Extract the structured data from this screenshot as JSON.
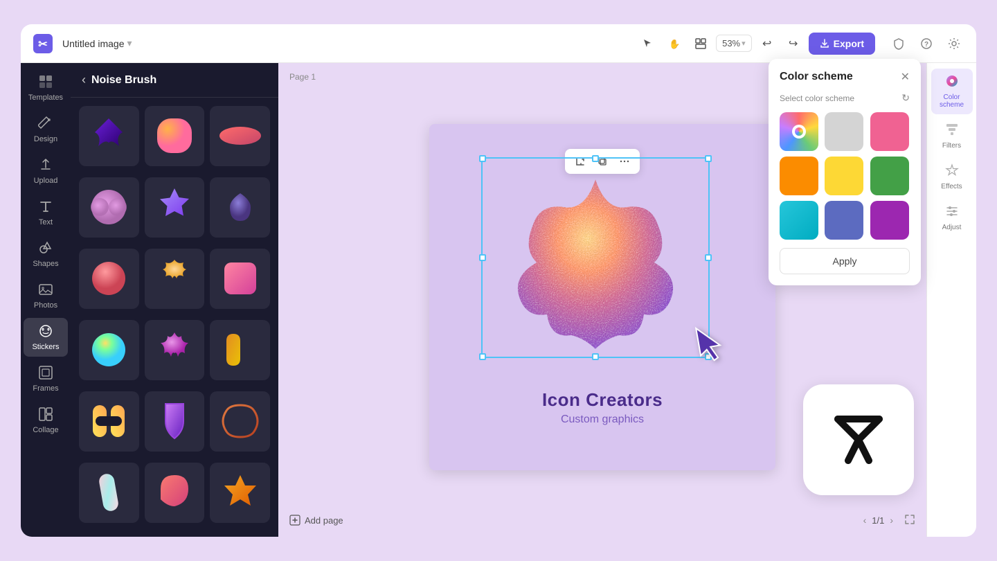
{
  "app": {
    "title": "Untitled image",
    "logo_symbol": "✂",
    "zoom": "53%"
  },
  "topbar": {
    "title": "Untitled image",
    "export_label": "Export",
    "zoom_label": "53%",
    "undo_icon": "↩",
    "redo_icon": "↪"
  },
  "sidebar": {
    "items": [
      {
        "id": "templates",
        "label": "Templates",
        "icon": "⊞"
      },
      {
        "id": "design",
        "label": "Design",
        "icon": "✦"
      },
      {
        "id": "upload",
        "label": "Upload",
        "icon": "⬆"
      },
      {
        "id": "text",
        "label": "Text",
        "icon": "T"
      },
      {
        "id": "shapes",
        "label": "Shapes",
        "icon": "△"
      },
      {
        "id": "photos",
        "label": "Photos",
        "icon": "⊡"
      },
      {
        "id": "stickers",
        "label": "Stickers",
        "icon": "◎",
        "active": true
      },
      {
        "id": "frames",
        "label": "Frames",
        "icon": "⊟"
      },
      {
        "id": "collage",
        "label": "Collage",
        "icon": "⊞"
      }
    ]
  },
  "sticker_panel": {
    "title": "Noise Brush",
    "back_label": "‹"
  },
  "right_panel": {
    "items": [
      {
        "id": "color-scheme",
        "label": "Color scheme",
        "icon": "◑",
        "active": true
      },
      {
        "id": "filters",
        "label": "Filters",
        "icon": "⊞"
      },
      {
        "id": "effects",
        "label": "Effects",
        "icon": "☆"
      },
      {
        "id": "adjust",
        "label": "Adjust",
        "icon": "⊜"
      }
    ]
  },
  "color_scheme": {
    "title": "Color scheme",
    "subtitle": "Select color scheme",
    "apply_label": "Apply",
    "swatches": [
      {
        "id": "rainbow",
        "type": "rainbow",
        "color": "#a855f7"
      },
      {
        "id": "gray",
        "type": "solid",
        "color": "#d4d4d4"
      },
      {
        "id": "pink",
        "type": "solid",
        "color": "#f06292"
      },
      {
        "id": "orange",
        "type": "solid",
        "color": "#fb8c00"
      },
      {
        "id": "yellow",
        "type": "solid",
        "color": "#fdd835"
      },
      {
        "id": "green",
        "type": "solid",
        "color": "#43a047"
      },
      {
        "id": "cyan",
        "type": "solid",
        "color": "#26c6da"
      },
      {
        "id": "blue",
        "type": "solid",
        "color": "#5c6bc0"
      },
      {
        "id": "purple",
        "type": "solid",
        "color": "#9c27b0"
      }
    ]
  },
  "canvas": {
    "page_label": "Page 1",
    "design_title": "Icon Creators",
    "design_subtitle": "Custom graphics",
    "add_page_label": "Add page",
    "page_num": "1/1"
  },
  "float_toolbar": {
    "btns": [
      "crop",
      "duplicate",
      "more"
    ]
  }
}
